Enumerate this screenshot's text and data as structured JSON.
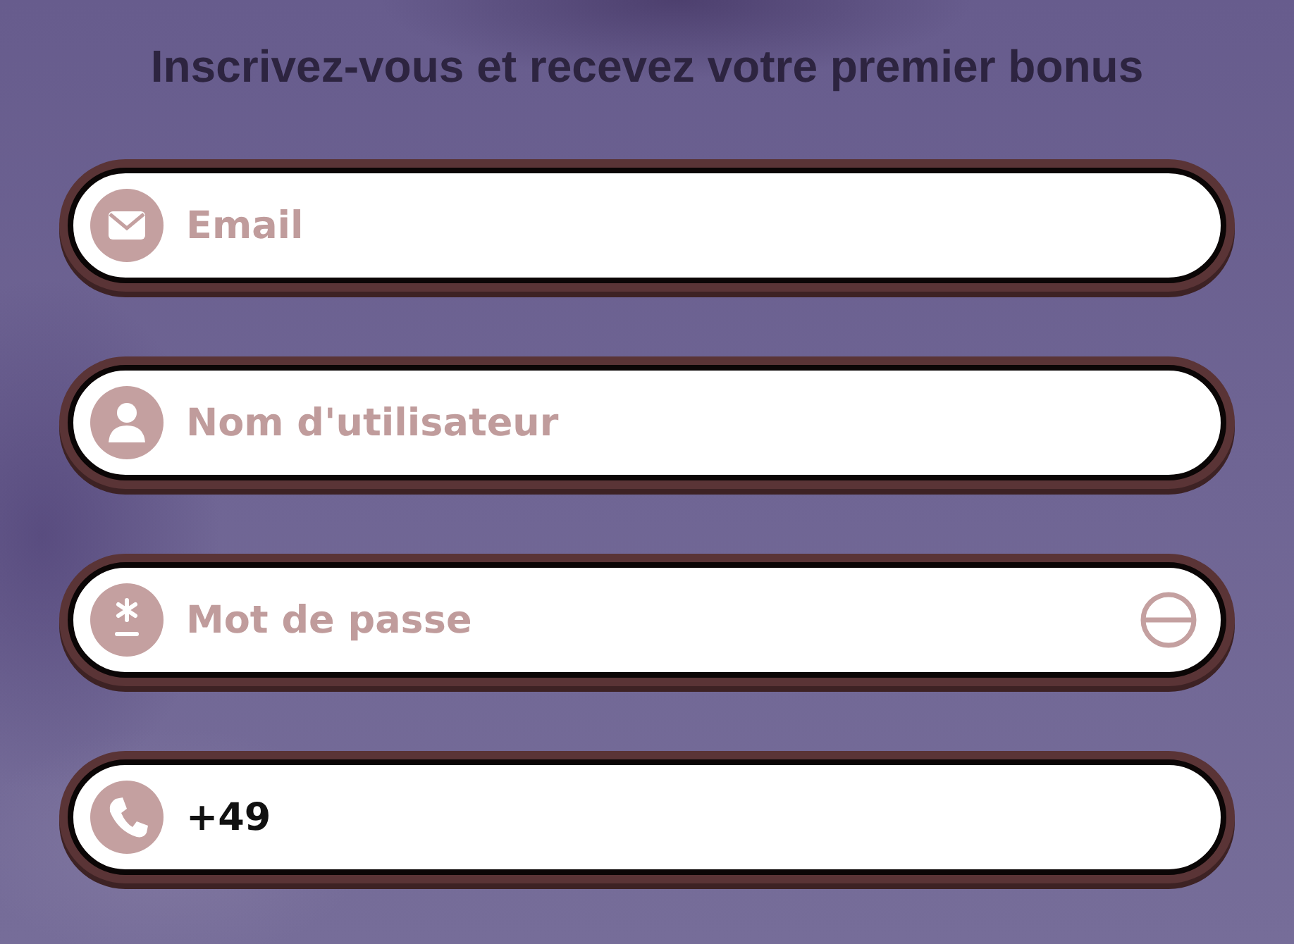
{
  "title": "Inscrivez-vous et recevez votre premier bonus",
  "fields": [
    {
      "kind": "email",
      "placeholder": "Email"
    },
    {
      "kind": "user",
      "placeholder": "Nom d'utilisateur"
    },
    {
      "kind": "password",
      "placeholder": "Mot de passe"
    },
    {
      "kind": "phone",
      "value": "+49"
    }
  ]
}
